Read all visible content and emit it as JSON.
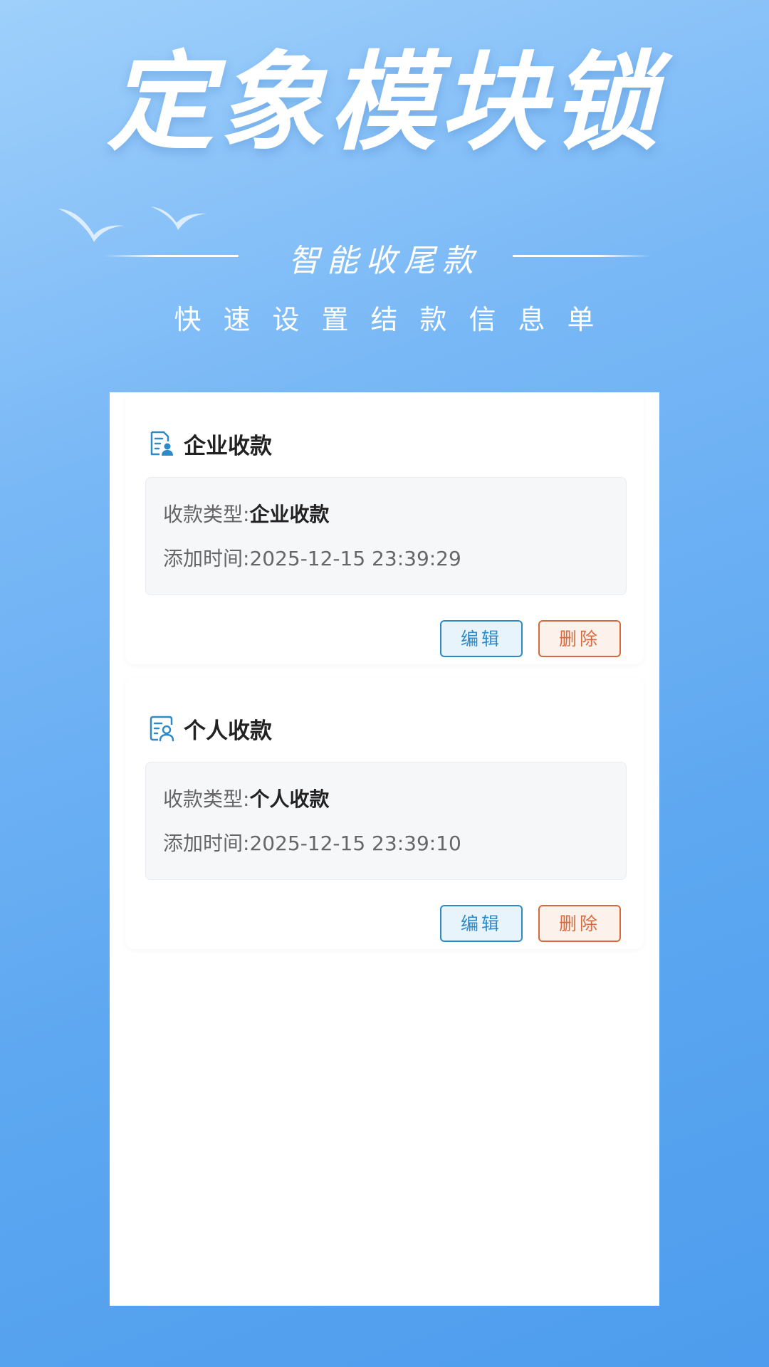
{
  "hero": {
    "title": "定象模块锁",
    "subtitle": "智能收尾款",
    "tagline": "快速设置结款信息单"
  },
  "records": [
    {
      "title": "企业收款",
      "icon": "document-user-icon",
      "type_label": "收款类型:",
      "type_value": "企业收款",
      "time_label": "添加时间:",
      "time_value": "2025-12-15 23:39:29",
      "edit_label": "编辑",
      "delete_label": "删除"
    },
    {
      "title": "个人收款",
      "icon": "person-card-icon",
      "type_label": "收款类型:",
      "type_value": "个人收款",
      "time_label": "添加时间:",
      "time_value": "2025-12-15 23:39:10",
      "edit_label": "编辑",
      "delete_label": "删除"
    }
  ],
  "colors": {
    "accent": "#2d8ac8",
    "danger": "#d66a3c",
    "background_top": "#9fd0fb",
    "background_bottom": "#4d9ced"
  }
}
